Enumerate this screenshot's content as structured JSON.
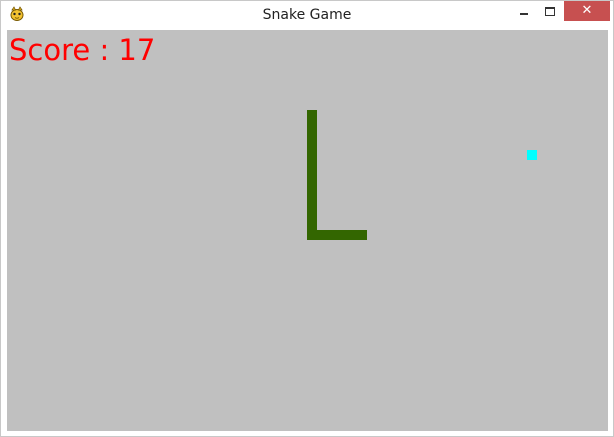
{
  "window": {
    "title": "Snake Game",
    "icon": "pygame-snake-icon",
    "controls": {
      "minimize_icon": "minimize-icon",
      "maximize_icon": "maximize-icon",
      "close_glyph": "✕",
      "close_color": "#c75050"
    }
  },
  "game": {
    "background_color": "#c0c0c0",
    "score_text": "Score : 17",
    "score_color": "#ff0000",
    "snake_color": "#336600",
    "food_color": "#00ffff"
  }
}
